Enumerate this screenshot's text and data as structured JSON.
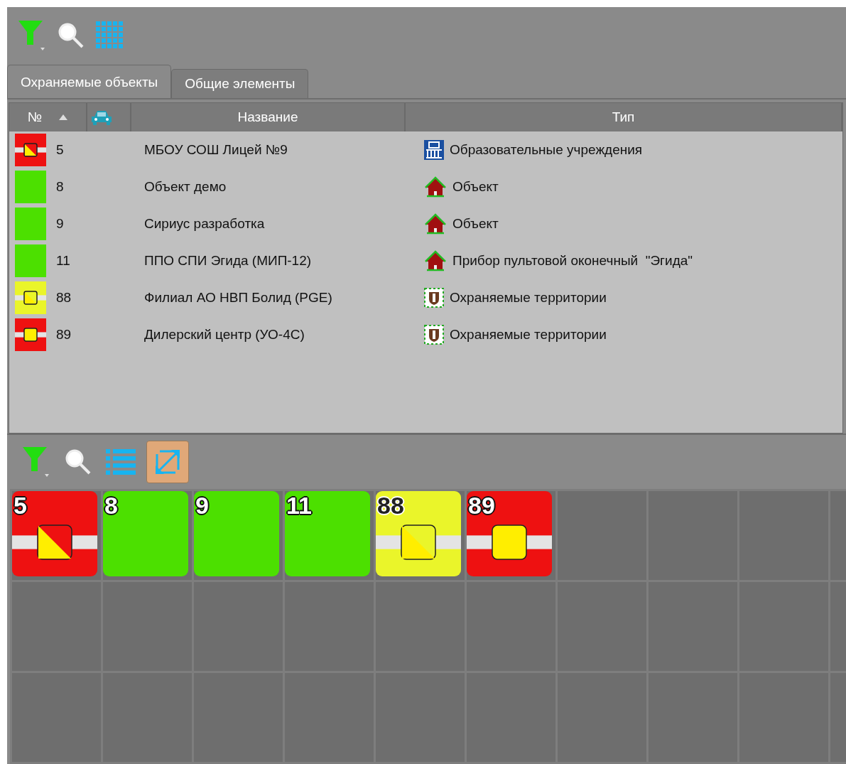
{
  "tabs": [
    {
      "label": "Охраняемые объекты",
      "selected": true
    },
    {
      "label": "Общие элементы",
      "selected": false
    }
  ],
  "table": {
    "columns": [
      "№",
      "Название",
      "Тип"
    ],
    "rows": [
      {
        "number": "5",
        "name": "МБОУ СОШ Лицей №9",
        "type": {
          "text": "Образовательные учреждения",
          "kind": "school"
        },
        "color": "#ee1111",
        "kind": "split"
      },
      {
        "number": "8",
        "name": "Объект демо",
        "type": {
          "text": "Объект",
          "kind": "house"
        },
        "color": "#4ce000",
        "kind": "plain"
      },
      {
        "number": "9",
        "name": "Сириус разработка",
        "type": {
          "text": "Объект",
          "kind": "house"
        },
        "color": "#4ce000",
        "kind": "plain"
      },
      {
        "number": "11",
        "name": "ППО СПИ Эгида (МИП-12)",
        "type": {
          "text": "Прибор пультовой оконечный  \"Эгида\"",
          "kind": "house"
        },
        "color": "#4ce000",
        "kind": "plain"
      },
      {
        "number": "88",
        "name": "Филиал АО НВП Болид (PGE)",
        "type": {
          "text": "Охраняемые территории",
          "kind": "shield"
        },
        "color": "#eaf52a",
        "kind": "split"
      },
      {
        "number": "89",
        "name": "Дилерский центр  (УО-4С)",
        "type": {
          "text": "Охраняемые территории",
          "kind": "shield"
        },
        "color": "#ee1111",
        "kind": "square"
      }
    ]
  },
  "bottom_toolbar": [
    {
      "kind": "filter",
      "selected": false
    },
    {
      "kind": "search",
      "selected": false
    },
    {
      "kind": "list",
      "selected": false
    },
    {
      "kind": "expand",
      "selected": true
    }
  ],
  "tiles": [
    {
      "number": "5",
      "color": "#ee1111",
      "kind": "split"
    },
    {
      "number": "8",
      "color": "#4ce000",
      "kind": "plain"
    },
    {
      "number": "9",
      "color": "#4ce000",
      "kind": "plain"
    },
    {
      "number": "11",
      "color": "#4ce000",
      "kind": "plain"
    },
    {
      "number": "88",
      "color": "#eaf52a",
      "kind": "split"
    },
    {
      "number": "89",
      "color": "#ee1111",
      "kind": "square"
    }
  ]
}
